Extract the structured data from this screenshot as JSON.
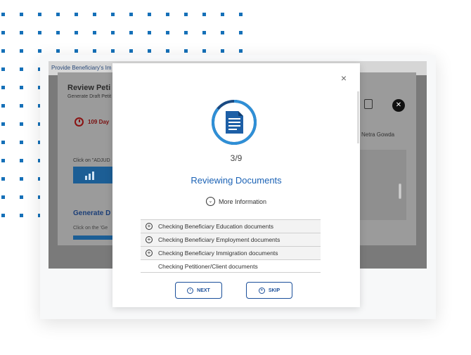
{
  "background_app": {
    "topbar_text": "Provide Beneficiary's Im",
    "panel_title": "Review Peti",
    "panel_subtitle": "Generate Draft Petit",
    "days_badge": "109 Day",
    "click_text": "Click on \"ADJUD",
    "generate_heading": "Generate D",
    "click_text2": "Click on the 'Ge",
    "user_name": "Netra Gowda",
    "close_glyph": "✕"
  },
  "modal": {
    "close_glyph": "×",
    "progress": "3/9",
    "title": "Reviewing Documents",
    "more_info_label": "More Information",
    "checklist": [
      {
        "label": "Checking Beneficiary Education documents",
        "expandable": true
      },
      {
        "label": "Checking Beneficiary Employment documents",
        "expandable": true
      },
      {
        "label": "Checking Beneficiary Immigration documents",
        "expandable": true
      },
      {
        "label": "Checking Petitioner/Client documents",
        "expandable": false
      }
    ],
    "buttons": {
      "next_label": "NEXT",
      "skip_label": "SKIP"
    }
  },
  "colors": {
    "accent_blue": "#1b62b5",
    "button_border": "#1b4f9a",
    "dot_blue": "#1570b8",
    "badge_red": "#7a1010"
  },
  "icons": [
    "document-icon",
    "clock-icon",
    "chevron-down-icon",
    "plus-circle-icon",
    "next-icon",
    "skip-icon",
    "clipboard-icon",
    "close-icon",
    "chart-icon"
  ]
}
